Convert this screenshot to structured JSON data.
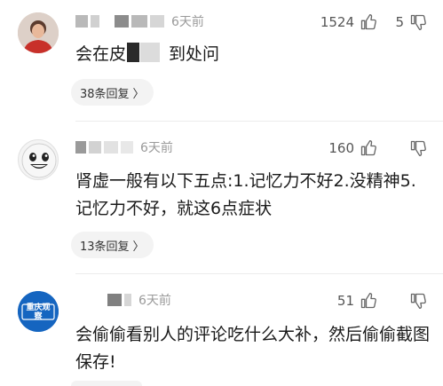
{
  "comments": [
    {
      "time": "6天前",
      "likes": "1524",
      "dislikes": "5",
      "text_before": "会在皮",
      "text_after": "到处问",
      "replies": "38条回复",
      "reply_arrow": "〉"
    },
    {
      "time": "6天前",
      "likes": "160",
      "dislikes": "",
      "text": "肾虚一般有以下五点:1.记忆力不好2.没精神5.记忆力不好，就这6点症状",
      "replies": "13条回复",
      "reply_arrow": "〉"
    },
    {
      "time": "6天前",
      "likes": "51",
      "dislikes": "",
      "text": "会偷偷看别人的评论吃什么大补，然后偷偷截图保存!",
      "avatar_text": "重庆观察"
    }
  ],
  "colors": {
    "text": "#1a1a1a",
    "meta": "#9a9a9a",
    "reply_bg": "#f3f3f3",
    "avatar3": "#1565c0"
  },
  "icons": [
    "thumb-up-icon",
    "thumb-down-icon",
    "chevron-right-icon"
  ]
}
